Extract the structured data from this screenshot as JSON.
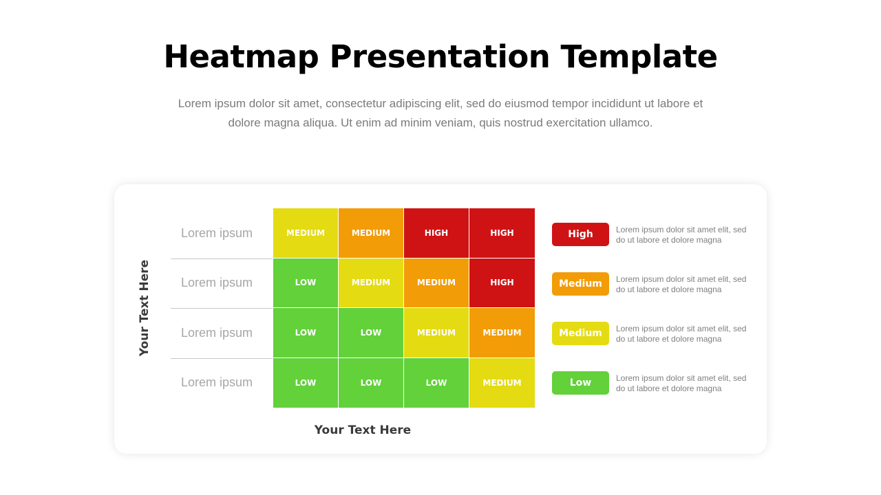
{
  "header": {
    "title": "Heatmap Presentation Template",
    "subtitle": "Lorem ipsum dolor sit amet, consectetur adipiscing elit, sed do eiusmod tempor incididunt ut labore et dolore magna aliqua. Ut enim ad minim veniam, quis nostrud exercitation ullamco."
  },
  "colors": {
    "HIGH": "#cf1315",
    "MEDIUM_ORANGE": "#f29c08",
    "MEDIUM_YELLOW": "#e4db12",
    "LOW": "#62d13a"
  },
  "chart_data": {
    "type": "heatmap",
    "title": "Heatmap Presentation Template",
    "xlabel": "Your Text Here",
    "ylabel": "Your Text Here",
    "rows": [
      "Lorem ipsum",
      "Lorem ipsum",
      "Lorem ipsum",
      "Lorem ipsum"
    ],
    "columns": [
      "",
      "",
      "",
      ""
    ],
    "cells": [
      [
        {
          "label": "MEDIUM",
          "level": "MEDIUM_YELLOW"
        },
        {
          "label": "MEDIUM",
          "level": "MEDIUM_ORANGE"
        },
        {
          "label": "HIGH",
          "level": "HIGH"
        },
        {
          "label": "HIGH",
          "level": "HIGH"
        }
      ],
      [
        {
          "label": "LOW",
          "level": "LOW"
        },
        {
          "label": "MEDIUM",
          "level": "MEDIUM_YELLOW"
        },
        {
          "label": "MEDIUM",
          "level": "MEDIUM_ORANGE"
        },
        {
          "label": "HIGH",
          "level": "HIGH"
        }
      ],
      [
        {
          "label": "LOW",
          "level": "LOW"
        },
        {
          "label": "LOW",
          "level": "LOW"
        },
        {
          "label": "MEDIUM",
          "level": "MEDIUM_YELLOW"
        },
        {
          "label": "MEDIUM",
          "level": "MEDIUM_ORANGE"
        }
      ],
      [
        {
          "label": "LOW",
          "level": "LOW"
        },
        {
          "label": "LOW",
          "level": "LOW"
        },
        {
          "label": "LOW",
          "level": "LOW"
        },
        {
          "label": "MEDIUM",
          "level": "MEDIUM_YELLOW"
        }
      ]
    ],
    "legend": [
      {
        "label": "High",
        "level": "HIGH",
        "description": "Lorem ipsum dolor sit amet elit, sed do ut labore et dolore magna"
      },
      {
        "label": "Medium",
        "level": "MEDIUM_ORANGE",
        "description": "Lorem ipsum dolor sit amet elit, sed do ut labore et dolore magna"
      },
      {
        "label": "Medium",
        "level": "MEDIUM_YELLOW",
        "description": "Lorem ipsum dolor sit amet elit, sed do ut labore et dolore magna"
      },
      {
        "label": "Low",
        "level": "LOW",
        "description": "Lorem ipsum dolor sit amet elit, sed do ut labore et dolore magna"
      }
    ],
    "legend_position": "right"
  }
}
